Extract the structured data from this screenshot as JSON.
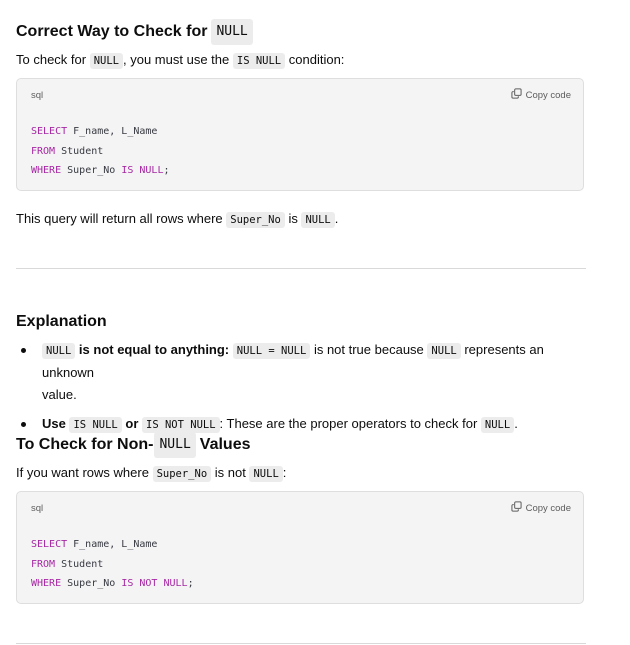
{
  "section1": {
    "title_text": "Correct Way to Check for",
    "title_code": "NULL",
    "intro_a": "To check for",
    "intro_code1": "NULL",
    "intro_b": ", you must use the",
    "intro_code2": "IS NULL",
    "intro_c": "condition:",
    "code": {
      "lang": "sql",
      "copy_label": "Copy code",
      "line1_kw": "SELECT",
      "line1_rest": " F_name, L_Name",
      "line2_kw": "FROM",
      "line2_rest": " Student",
      "line3_kw": "WHERE",
      "line3_mid": " Super_No ",
      "line3_kw2": "IS NULL",
      "line3_end": ";"
    },
    "result_a": "This query will return all rows where",
    "result_code1": "Super_No",
    "result_b": "is",
    "result_code2": "NULL",
    "result_c": "."
  },
  "explanation": {
    "title": "Explanation",
    "b1_code": "NULL",
    "b1_bold": "is not equal to anything:",
    "b1_code2": "NULL = NULL",
    "b1_text": "is not true because",
    "b1_code3": "NULL",
    "b1_text2": "represents an unknown",
    "b1_text3": "value.",
    "b2_bold1": "Use",
    "b2_code1": "IS NULL",
    "b2_bold2": "or",
    "b2_code2": "IS NOT NULL",
    "b2_text": ": These are the proper operators to check for",
    "b2_code3": "NULL",
    "b2_end": "."
  },
  "section2": {
    "title_a": "To Check for Non-",
    "title_code": "NULL",
    "title_b": "Values",
    "intro_a": "If you want rows where",
    "intro_code1": "Super_No",
    "intro_b": "is not",
    "intro_code2": "NULL",
    "intro_c": ":",
    "code": {
      "lang": "sql",
      "copy_label": "Copy code",
      "line1_kw": "SELECT",
      "line1_rest": " F_name, L_Name",
      "line2_kw": "FROM",
      "line2_rest": " Student",
      "line3_kw": "WHERE",
      "line3_mid": " Super_No ",
      "line3_kw2": "IS NOT NULL",
      "line3_end": ";"
    }
  }
}
